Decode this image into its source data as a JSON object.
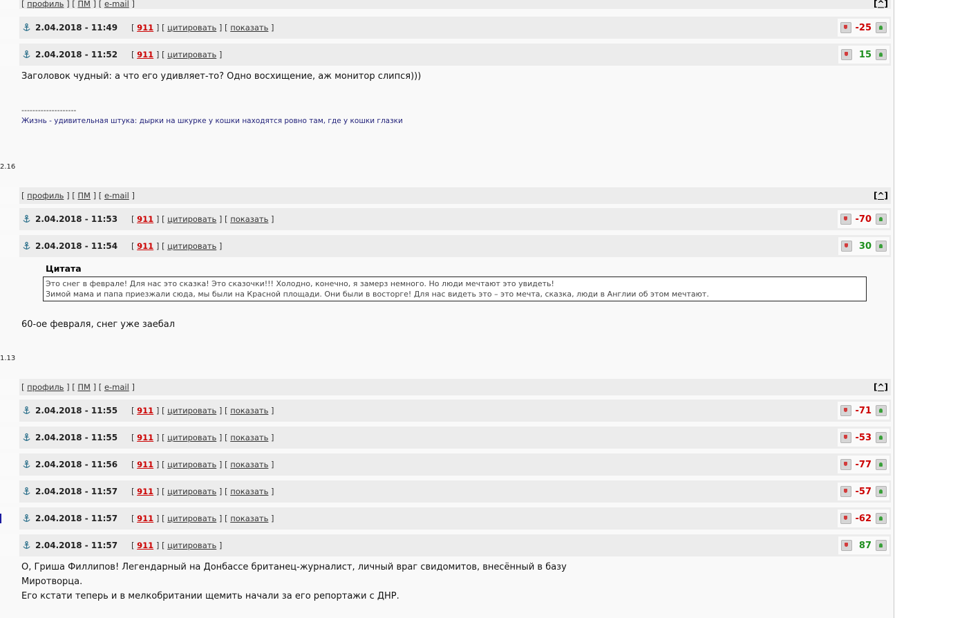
{
  "links": {
    "profile": "профиль",
    "pm": "ПМ",
    "email": "e-mail",
    "top": "[^]"
  },
  "header_labels": {
    "quote": "цитировать",
    "show": "показать",
    "num": "911"
  },
  "posts": [
    {
      "date": "2.04.2018 - 11:49",
      "score": "-25"
    },
    {
      "date": "2.04.2018 - 11:52",
      "score": "15"
    },
    {
      "date": "2.04.2018 - 11:53",
      "score": "-70"
    },
    {
      "date": "2.04.2018 - 11:54",
      "score": "30"
    },
    {
      "date": "2.04.2018 - 11:55",
      "score": "-71"
    },
    {
      "date": "2.04.2018 - 11:55",
      "score": "-53"
    },
    {
      "date": "2.04.2018 - 11:56",
      "score": "-77"
    },
    {
      "date": "2.04.2018 - 11:57",
      "score": "-57"
    },
    {
      "date": "2.04.2018 - 11:57",
      "score": "-62"
    },
    {
      "date": "2.04.2018 - 11:57",
      "score": "87"
    }
  ],
  "post2": {
    "text": "Заголовок чудный: а что его удивляет-то? Одно восхищение, аж монитор слипся)))",
    "sig_line": "--------------------",
    "sig": "Жизнь - удивительная штука: дырки на шкурке у кошки находятся ровно там, где у кошки глазки",
    "side": "2.16"
  },
  "post4": {
    "quote_title": "Цитата",
    "quote_line1": "Это снег в феврале! Для нас это сказка! Это сказочки!!! Холодно, конечно, я замерз немного. Но люди мечтают это увидеть!",
    "quote_line2": "Зимой мама и папа приезжали сюда, мы были на Красной площади. Они были в восторге! Для нас видеть это – это мечта, сказка, люди в Англии об этом мечтают.",
    "text": "60-ое февраля, снег уже заебал",
    "side": "1.13"
  },
  "post10": {
    "text": "О, Гриша Филлипов! Легендарный на Донбассе британец-журналист, личный враг свидомитов, внесённый в базу\nМиротворца.\nЕго кстати теперь и в мелкобритании щемить начали за его репортажи с ДНР."
  }
}
